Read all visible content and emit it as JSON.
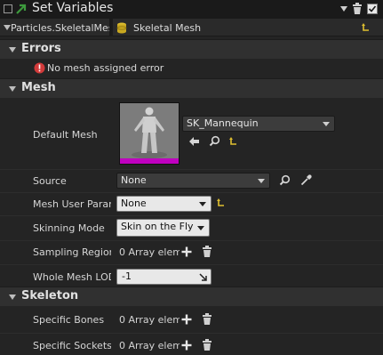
{
  "title": "Set Variables",
  "parameter": {
    "name": "Particles.SkeletalMes",
    "type": "Skeletal Mesh"
  },
  "sections": {
    "errors": "Errors",
    "mesh": "Mesh",
    "skeleton": "Skeleton"
  },
  "errors": {
    "message": "No mesh assigned error"
  },
  "mesh": {
    "default_mesh_label": "Default Mesh",
    "default_mesh_value": "SK_Mannequin",
    "source_label": "Source",
    "source_value": "None",
    "mesh_user_param_label": "Mesh User Parar",
    "mesh_user_param_value": "None",
    "skinning_mode_label": "Skinning Mode",
    "skinning_mode_value": "Skin on the Fly",
    "sampling_region_label": "Sampling Region",
    "sampling_region_value": "0 Array elem",
    "whole_mesh_lod_label": "Whole Mesh LOD",
    "whole_mesh_lod_value": "-1"
  },
  "skeleton": {
    "specific_bones_label": "Specific Bones",
    "specific_bones_value": "0 Array elem",
    "specific_sockets_label": "Specific Sockets",
    "specific_sockets_value": "0 Array elem"
  },
  "colors": {
    "accent_green": "#3d9a3d",
    "error_red": "#d23a3a",
    "thumbnail_border": "#c000c0",
    "yellow_icon": "#e0c030"
  }
}
